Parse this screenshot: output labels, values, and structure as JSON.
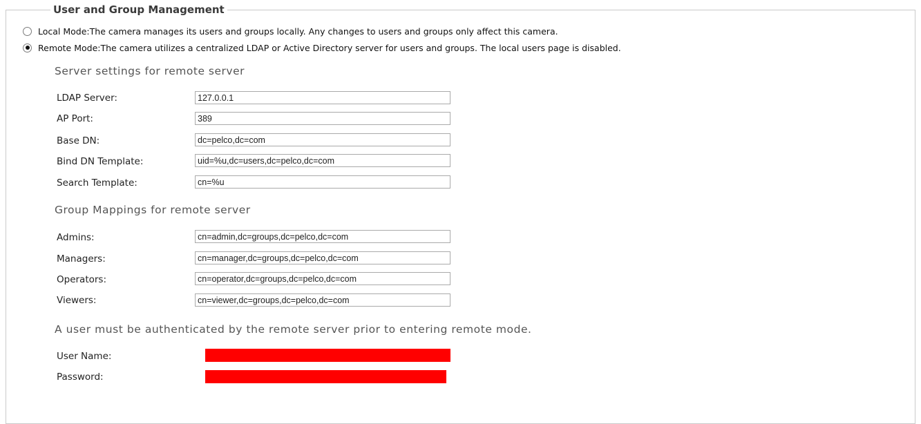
{
  "legend": "User and Group Management",
  "mode_options": [
    {
      "label": "Local Mode:The camera manages its users and groups locally. Any changes to users and groups only affect this camera.",
      "checked": false
    },
    {
      "label": "Remote Mode:The camera utilizes a centralized LDAP or Active Directory server for users and groups. The local users page is disabled.",
      "checked": true
    }
  ],
  "server_settings": {
    "heading": "Server settings for remote server",
    "fields": [
      {
        "label": "LDAP Server:",
        "value": "127.0.0.1"
      },
      {
        "label": "AP Port:",
        "value": "389"
      },
      {
        "label": "Base DN:",
        "value": "dc=pelco,dc=com"
      },
      {
        "label": "Bind DN Template:",
        "value": "uid=%u,dc=users,dc=pelco,dc=com"
      },
      {
        "label": "Search Template:",
        "value": "cn=%u"
      }
    ]
  },
  "group_mappings": {
    "heading": "Group Mappings for remote server",
    "fields": [
      {
        "label": "Admins:",
        "value": "cn=admin,dc=groups,dc=pelco,dc=com"
      },
      {
        "label": "Managers:",
        "value": "cn=manager,dc=groups,dc=pelco,dc=com"
      },
      {
        "label": "Operators:",
        "value": "cn=operator,dc=groups,dc=pelco,dc=com"
      },
      {
        "label": "Viewers:",
        "value": "cn=viewer,dc=groups,dc=pelco,dc=com"
      }
    ]
  },
  "auth": {
    "note": "A user must be authenticated by the remote server prior to entering remote mode.",
    "username_label": "User Name:",
    "password_label": "Password:"
  },
  "colors": {
    "redaction": "#ff0000"
  }
}
